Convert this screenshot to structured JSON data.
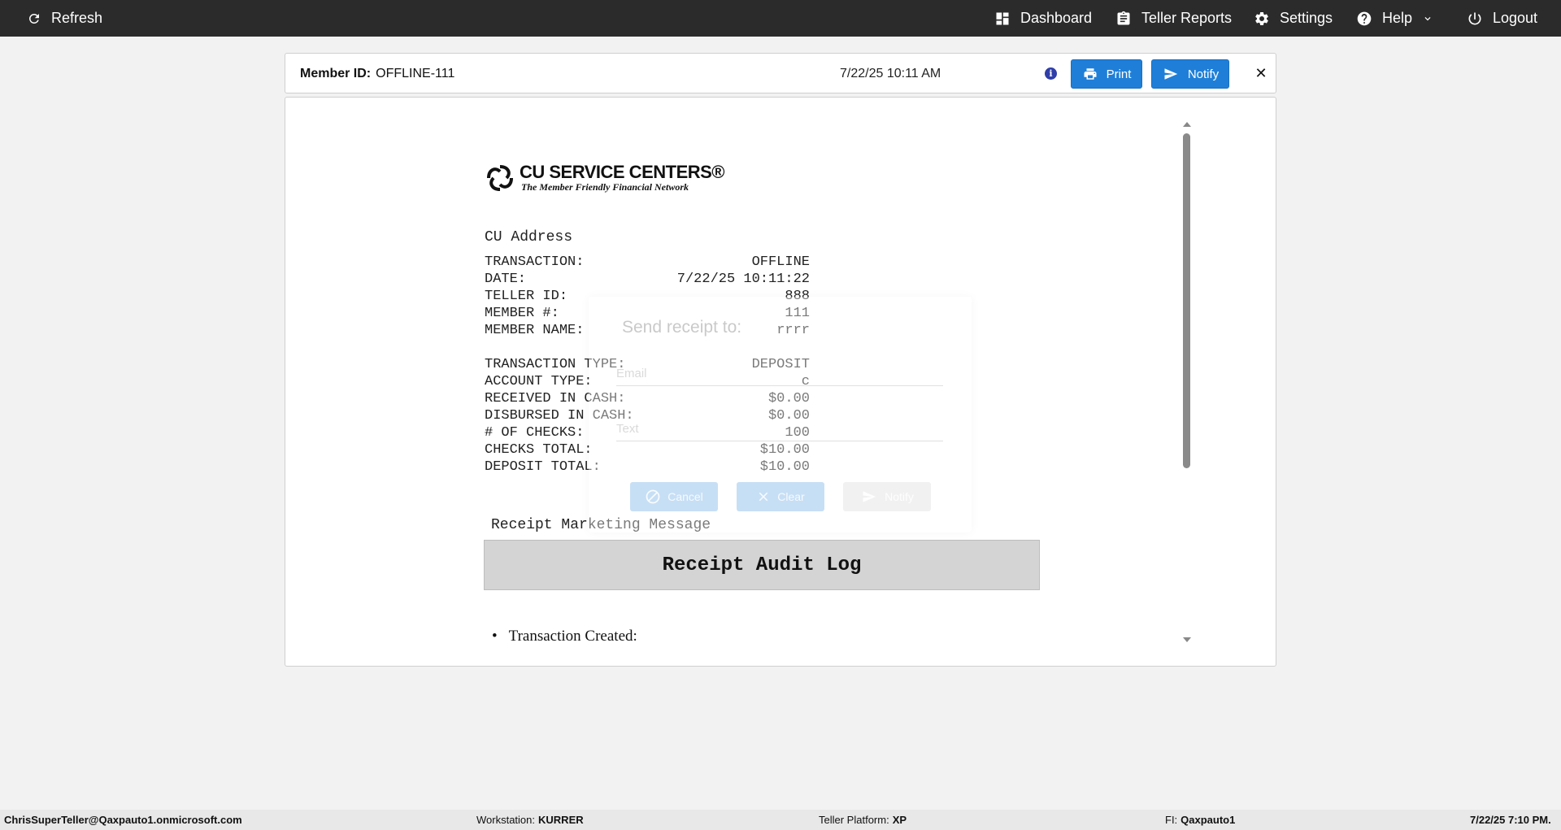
{
  "topbar": {
    "refresh": "Refresh",
    "dashboard": "Dashboard",
    "teller_reports": "Teller Reports",
    "settings": "Settings",
    "help": "Help",
    "logout": "Logout"
  },
  "header": {
    "member_id_label": "Member ID:",
    "member_id_value": "OFFLINE-111",
    "date": "7/22/25 10:11 AM",
    "print_label": "Print",
    "notify_label": "Notify",
    "close_label": "✕",
    "info_glyph": "i"
  },
  "receipt": {
    "logo_title": "CU SERVICE CENTERS®",
    "logo_tagline": "The Member Friendly Financial Network",
    "cu_address": "CU Address",
    "rows_top": [
      {
        "label": "TRANSACTION:",
        "value": "OFFLINE"
      },
      {
        "label": "DATE:",
        "value": "7/22/25 10:11:22"
      },
      {
        "label": "TELLER ID:",
        "value": "888"
      },
      {
        "label": "MEMBER #:",
        "value": "111"
      },
      {
        "label": "MEMBER NAME:",
        "value": "rrrr"
      }
    ],
    "rows_bottom": [
      {
        "label": "TRANSACTION TYPE:",
        "value": "DEPOSIT"
      },
      {
        "label": "ACCOUNT TYPE:",
        "value": "c"
      },
      {
        "label": "RECEIVED IN CASH:",
        "value": "$0.00"
      },
      {
        "label": "DISBURSED IN CASH:",
        "value": "$0.00"
      },
      {
        "label": "# OF CHECKS:",
        "value": "100"
      },
      {
        "label": "CHECKS TOTAL:",
        "value": "$10.00"
      },
      {
        "label": "DEPOSIT TOTAL:",
        "value": "$10.00"
      }
    ],
    "marketing_message": "Receipt Marketing Message",
    "audit_log_title": "Receipt Audit Log",
    "audit_items": [
      "Transaction Created:"
    ]
  },
  "modal": {
    "title": "Send receipt to:",
    "email_placeholder": "Email",
    "text_placeholder": "Text",
    "cancel_label": "Cancel",
    "clear_label": "Clear",
    "notify_label": "Notify"
  },
  "status": {
    "user": "ChrisSuperTeller@Qaxpauto1.onmicrosoft.com",
    "workstation_label": "Workstation:",
    "workstation_value": "KURRER",
    "platform_label": "Teller Platform:",
    "platform_value": "XP",
    "fi_label": "FI:",
    "fi_value": "Qaxpauto1",
    "datetime": "7/22/25 7:10 PM."
  },
  "colors": {
    "topbar_bg": "#2b2b2b",
    "primary_button": "#1f7fd8",
    "info_icon": "#2f3ea8"
  }
}
